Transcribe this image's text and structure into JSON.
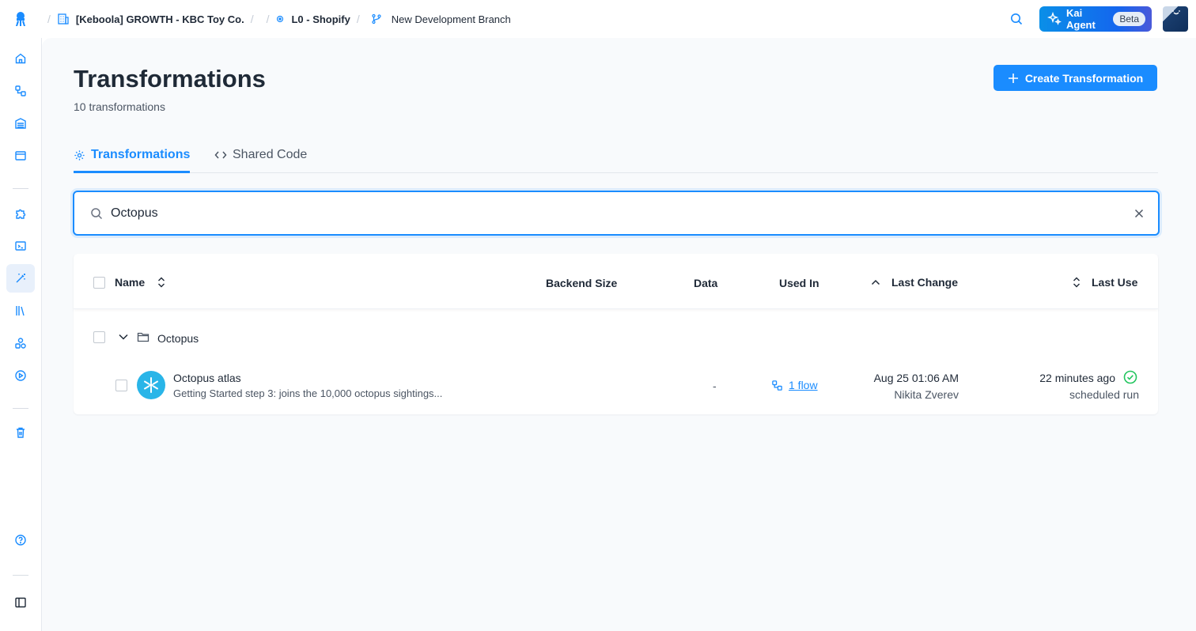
{
  "topbar": {
    "breadcrumbs": [
      {
        "label": "[Keboola] GROWTH - KBC Toy Co.",
        "icon": "building-icon"
      },
      {
        "label": "L0 - Shopify",
        "icon": "project-icon"
      },
      {
        "label": "New Development Branch",
        "icon": "git-branch-icon"
      }
    ],
    "kai_label": "Kai Agent",
    "kai_badge": "Beta"
  },
  "page": {
    "title": "Transformations",
    "subtitle": "10 transformations",
    "create_label": "Create Transformation"
  },
  "tabs": [
    {
      "label": "Transformations",
      "active": true
    },
    {
      "label": "Shared Code",
      "active": false
    }
  ],
  "search": {
    "value": "Octopus",
    "placeholder": ""
  },
  "table": {
    "columns": {
      "name": "Name",
      "backend_size": "Backend Size",
      "data": "Data",
      "used_in": "Used In",
      "last_change": "Last Change",
      "last_use": "Last Use"
    },
    "folder": "Octopus",
    "rows": [
      {
        "name": "Octopus atlas",
        "description": "Getting Started step 3: joins the 10,000 octopus sightings...",
        "data": "-",
        "used_in": "1 flow",
        "last_change_date": "Aug 25 01:06 AM",
        "last_change_user": "Nikita Zverev",
        "last_use_time": "22 minutes ago",
        "last_use_type": "scheduled run",
        "status": "success"
      }
    ]
  },
  "colors": {
    "accent": "#1a8cff",
    "success": "#22c55e",
    "snowflake": "#29b5e8"
  }
}
